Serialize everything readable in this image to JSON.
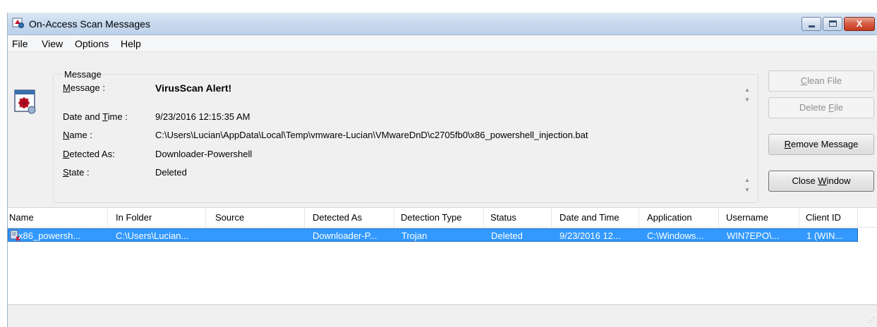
{
  "window": {
    "title": "On-Access Scan Messages",
    "controls": {
      "minimize": "minimize",
      "maximize": "maximize",
      "close": "X"
    }
  },
  "menu": [
    "File",
    "View",
    "Options",
    "Help"
  ],
  "details": {
    "group_label": "Message",
    "message": {
      "label_pre": "",
      "label_u": "M",
      "label_post": "essage :",
      "value": "VirusScan Alert!"
    },
    "date_time": {
      "label_pre": "Date and ",
      "label_u": "T",
      "label_post": "ime :",
      "value": "9/23/2016 12:15:35 AM"
    },
    "name": {
      "label_pre": "",
      "label_u": "N",
      "label_post": "ame :",
      "value": "C:\\Users\\Lucian\\AppData\\Local\\Temp\\vmware-Lucian\\VMwareDnD\\c2705fb0\\x86_powershell_injection.bat"
    },
    "detected_as": {
      "label_pre": "",
      "label_u": "D",
      "label_post": "etected As:",
      "value": "Downloader-Powershell"
    },
    "state": {
      "label_pre": "",
      "label_u": "S",
      "label_post": "tate :",
      "value": "Deleted"
    }
  },
  "buttons": {
    "clean_file": {
      "pre": "",
      "u": "C",
      "post": "lean File",
      "enabled": false
    },
    "delete_file": {
      "pre": "Delete ",
      "u": "F",
      "post": "ile",
      "enabled": false
    },
    "remove_message": {
      "pre": "",
      "u": "R",
      "post": "emove Message",
      "enabled": true
    },
    "close_window": {
      "pre": "Close ",
      "u": "W",
      "post": "indow",
      "enabled": true
    }
  },
  "table": {
    "columns": [
      "Name",
      "In Folder",
      "Source",
      "Detected As",
      "Detection Type",
      "Status",
      "Date and Time",
      "Application",
      "Username",
      "Client ID"
    ],
    "rows": [
      [
        "x86_powersh...",
        "C:\\Users\\Lucian...",
        "",
        "Downloader-P...",
        "Trojan",
        "Deleted",
        "9/23/2016 12...",
        "C:\\Windows...",
        "WIN7EPO\\...",
        "1 (WIN..."
      ]
    ],
    "selected_row": 0
  },
  "icons": {
    "app": "shield-scan-icon",
    "message": "virus-alert-icon",
    "row": "infected-file-icon"
  },
  "colors": {
    "selection": "#3399ff",
    "titlebar": "#c6d8ee",
    "close_button": "#d65a41"
  }
}
